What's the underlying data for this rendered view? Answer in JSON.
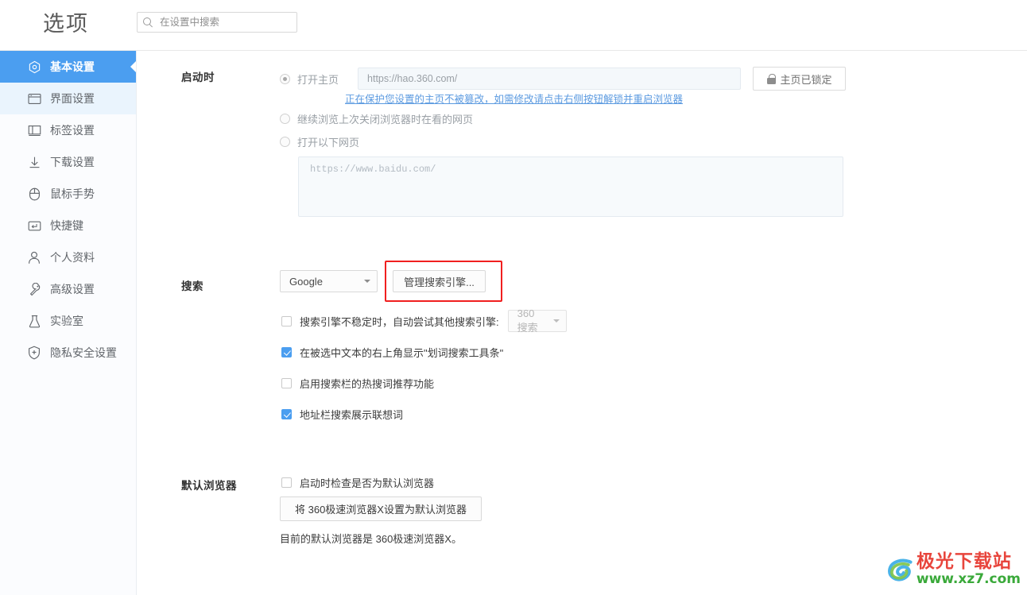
{
  "header": {
    "title": "选项",
    "search_placeholder": "在设置中搜索",
    "search_value": ""
  },
  "sidebar": {
    "items": [
      {
        "label": "基本设置",
        "icon": "hexagon-target-icon",
        "state": "active"
      },
      {
        "label": "界面设置",
        "icon": "window-icon",
        "state": "hovered"
      },
      {
        "label": "标签设置",
        "icon": "tab-icon",
        "state": "normal"
      },
      {
        "label": "下载设置",
        "icon": "download-arrow-icon",
        "state": "normal"
      },
      {
        "label": "鼠标手势",
        "icon": "mouse-icon",
        "state": "normal"
      },
      {
        "label": "快捷键",
        "icon": "keyboard-key-icon",
        "state": "normal"
      },
      {
        "label": "个人资料",
        "icon": "user-icon",
        "state": "normal"
      },
      {
        "label": "高级设置",
        "icon": "wrench-icon",
        "state": "normal"
      },
      {
        "label": "实验室",
        "icon": "flask-icon",
        "state": "normal"
      },
      {
        "label": "隐私安全设置",
        "icon": "shield-plus-icon",
        "state": "normal"
      }
    ]
  },
  "startup": {
    "label": "启动时",
    "option_homepage": "打开主页",
    "homepage_url": "https://hao.360.com/",
    "lock_button": "主页已锁定",
    "lock_icon": "lock-icon",
    "protect_hint": "正在保护您设置的主页不被篡改，如需修改请点击右侧按钮解锁并重启浏览器",
    "option_restore": "继续浏览上次关闭浏览器时在看的网页",
    "option_pages": "打开以下网页",
    "pages_value": "https://www.baidu.com/",
    "selected": "option_homepage"
  },
  "search": {
    "label": "搜索",
    "engine_selected": "Google",
    "manage_button": "管理搜索引擎...",
    "manage_button_highlighted": true,
    "highlight_color": "#f01f1f",
    "fallback": {
      "label": "搜索引擎不稳定时，自动尝试其他搜索引擎:",
      "checked": false,
      "engine_selected": "360搜索",
      "engine_disabled": true
    },
    "checkboxes": [
      {
        "label": "在被选中文本的右上角显示\"划词搜索工具条\"",
        "checked": true
      },
      {
        "label": "启用搜索栏的热搜词推荐功能",
        "checked": false
      },
      {
        "label": "地址栏搜索展示联想词",
        "checked": true
      }
    ]
  },
  "default_browser": {
    "label": "默认浏览器",
    "check_on_startup": {
      "label": "启动时检查是否为默认浏览器",
      "checked": false
    },
    "set_button": "将 360极速浏览器X设置为默认浏览器",
    "status_text": "目前的默认浏览器是 360极速浏览器X。"
  },
  "watermark": {
    "title": "极光下载站",
    "url": "www.xz7.com"
  },
  "colors": {
    "accent": "#4b9ef0",
    "link": "#5b9ae0",
    "highlight": "#f01f1f"
  }
}
